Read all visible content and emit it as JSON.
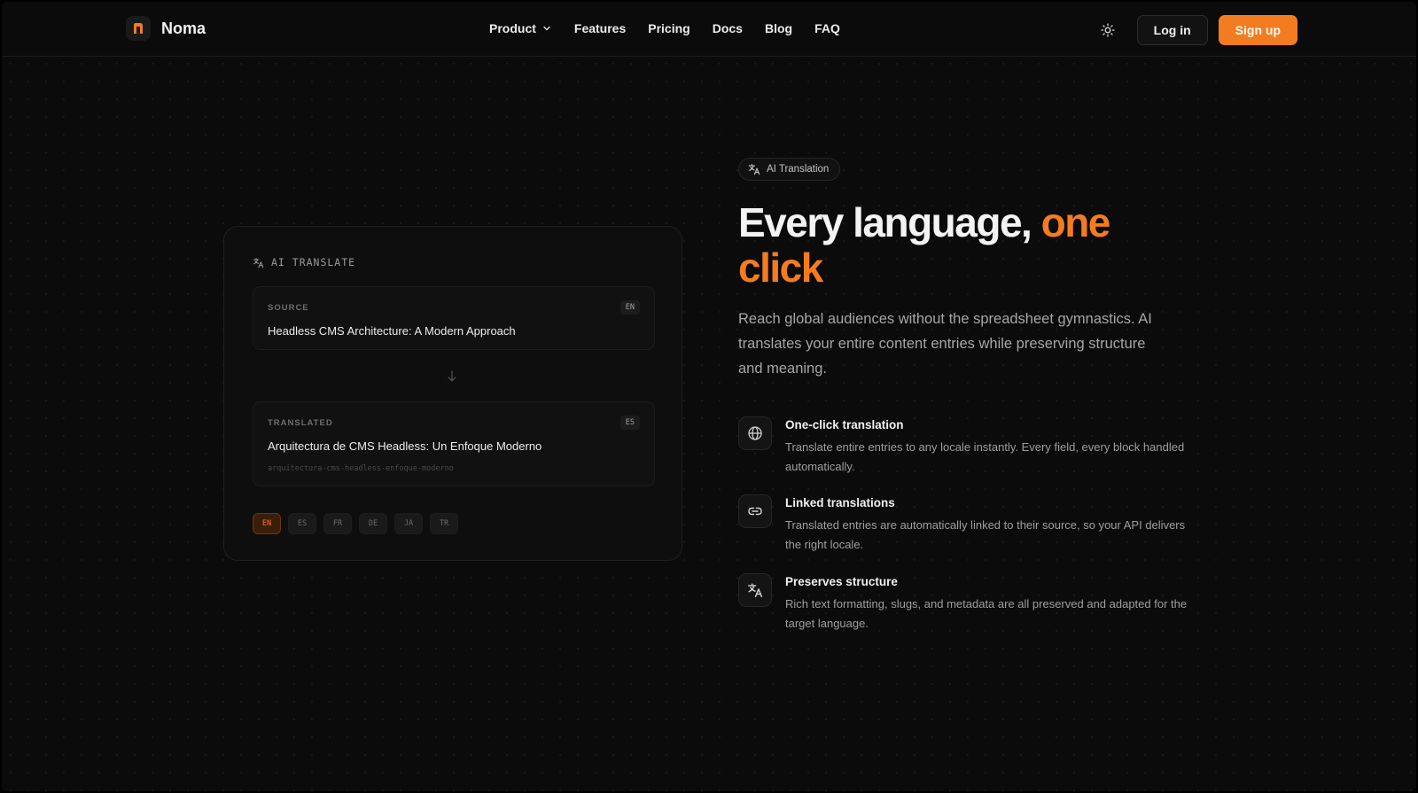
{
  "nav": {
    "brand": "Noma",
    "links": [
      "Product",
      "Features",
      "Pricing",
      "Docs",
      "Blog",
      "FAQ"
    ],
    "login_label": "Log in",
    "signup_label": "Sign up"
  },
  "card": {
    "header": "AI TRANSLATE",
    "source": {
      "label": "SOURCE",
      "code": "EN",
      "text": "Headless CMS Architecture: A Modern Approach"
    },
    "translated": {
      "label": "TRANSLATED",
      "code": "ES",
      "text": "Arquitectura de CMS Headless: Un Enfoque Moderno",
      "slug": "arquitectura-cms-headless-enfoque-moderno"
    },
    "locales": [
      "EN",
      "ES",
      "FR",
      "DE",
      "JA",
      "TR"
    ],
    "active_locale": "EN"
  },
  "hero": {
    "pill": "AI Translation",
    "headline_main": "Every language, ",
    "headline_accent_1": "one",
    "headline_accent_2": "click",
    "lead": "Reach global audiences without the spreadsheet gymnastics. AI translates your entire content entries while preserving structure and meaning."
  },
  "features": [
    {
      "icon": "globe-icon",
      "title": "One-click translation",
      "desc": "Translate entire entries to any locale instantly. Every field, every block handled automatically."
    },
    {
      "icon": "link-icon",
      "title": "Linked translations",
      "desc": "Translated entries are automatically linked to their source, so your API delivers the right locale."
    },
    {
      "icon": "translate-icon",
      "title": "Preserves structure",
      "desc": "Rich text formatting, slugs, and metadata are all preserved and adapted for the target language."
    }
  ],
  "colors": {
    "accent": "#f47c20",
    "background": "#0b0b0b"
  }
}
